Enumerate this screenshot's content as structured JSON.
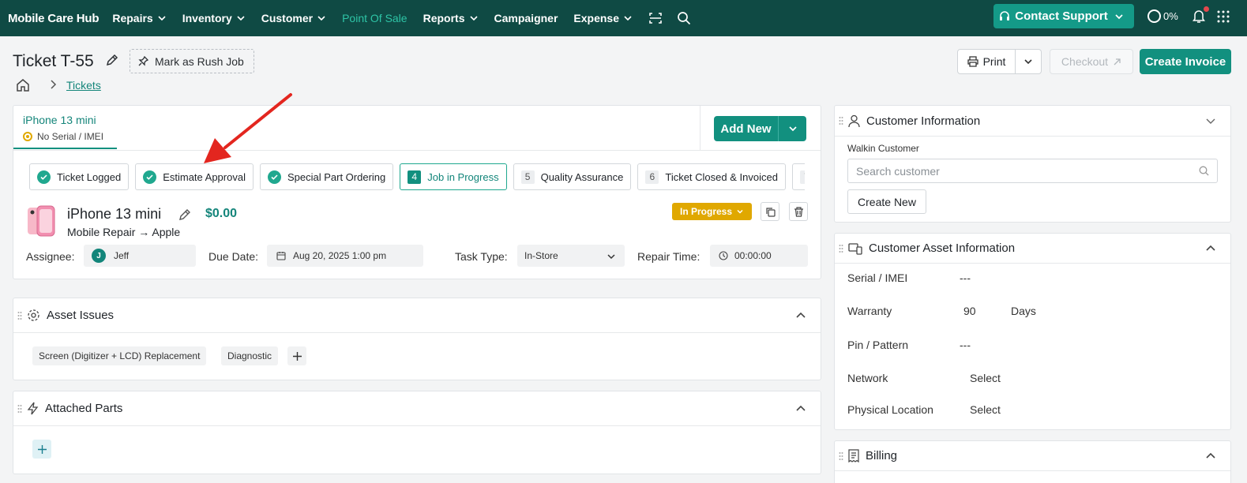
{
  "nav": {
    "brand": "Mobile Care Hub",
    "items": [
      {
        "label": "Repairs",
        "has_dropdown": true
      },
      {
        "label": "Inventory",
        "has_dropdown": true
      },
      {
        "label": "Customer",
        "has_dropdown": true
      },
      {
        "label": "Point Of Sale",
        "has_dropdown": false,
        "active": true
      },
      {
        "label": "Reports",
        "has_dropdown": true
      },
      {
        "label": "Campaigner",
        "has_dropdown": false
      },
      {
        "label": "Expense",
        "has_dropdown": true
      }
    ],
    "support_label": "Contact Support",
    "progress": "0%",
    "accent_color": "#0f4a44",
    "active_color": "#2ec4a6"
  },
  "header": {
    "title": "Ticket T-55",
    "rush_label": "Mark as Rush Job",
    "breadcrumb_link": "Tickets",
    "print_label": "Print",
    "checkout_label": "Checkout",
    "invoice_label": "Create Invoice"
  },
  "device_tab": {
    "name": "iPhone 13 mini",
    "serial": "No Serial / IMEI",
    "add_new_label": "Add New"
  },
  "steps": [
    {
      "label": "Ticket Logged",
      "state": "done"
    },
    {
      "label": "Estimate Approval",
      "state": "done"
    },
    {
      "label": "Special Part Ordering",
      "state": "done"
    },
    {
      "num": "4",
      "label": "Job in Progress",
      "state": "current"
    },
    {
      "num": "5",
      "label": "Quality Assurance",
      "state": "pending"
    },
    {
      "num": "6",
      "label": "Ticket Closed & Invoiced",
      "state": "pending"
    },
    {
      "num": "7",
      "label": "",
      "state": "pending"
    }
  ],
  "device": {
    "name": "iPhone 13 mini",
    "price": "$0.00",
    "category": "Mobile Repair → Apple",
    "status": "In Progress",
    "status_color": "#e0a800",
    "assignee_label": "Assignee:",
    "assignee_initial": "J",
    "assignee_name": "Jeff",
    "due_label": "Due Date:",
    "due_value": "Aug 20, 2025 1:00 pm",
    "task_label": "Task Type:",
    "task_value": "In-Store",
    "repair_label": "Repair Time:",
    "repair_value": "00:00:00"
  },
  "asset_issues": {
    "title": "Asset Issues",
    "chips": [
      "Screen (Digitizer + LCD) Replacement",
      "Diagnostic"
    ]
  },
  "attached_parts": {
    "title": "Attached Parts"
  },
  "customer_info": {
    "title": "Customer Information",
    "walkin_label": "Walkin Customer",
    "search_placeholder": "Search customer",
    "create_new_label": "Create New"
  },
  "asset_info": {
    "title": "Customer Asset Information",
    "serial_label": "Serial / IMEI",
    "serial_value": "---",
    "warranty_label": "Warranty",
    "warranty_value": "90",
    "warranty_unit": "Days",
    "pin_label": "Pin / Pattern",
    "pin_value": "---",
    "network_label": "Network",
    "network_value": "Select",
    "location_label": "Physical Location",
    "location_value": "Select"
  },
  "billing": {
    "title": "Billing"
  }
}
